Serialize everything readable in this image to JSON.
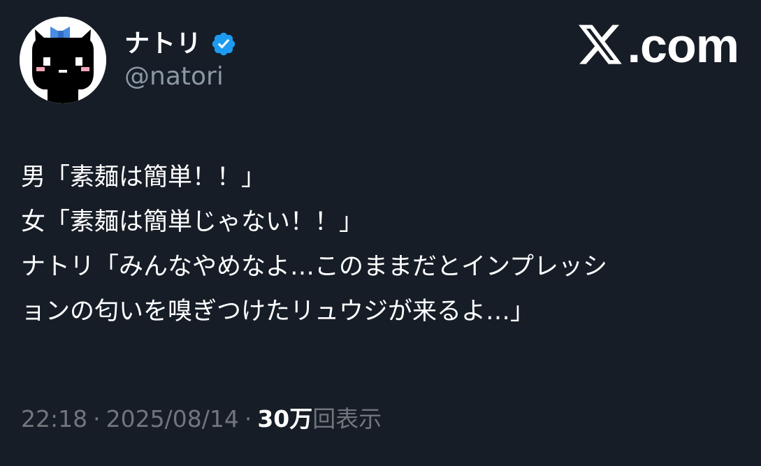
{
  "author": {
    "name": "ナトリ",
    "handle": "@natori",
    "verified": true,
    "avatar_icon": "pixel-cat-avatar"
  },
  "site": {
    "logo_icon": "x-logo-icon",
    "name_suffix": ".com"
  },
  "tweet": {
    "lines": [
      "男「素麺は簡単！！」",
      "女「素麺は簡単じゃない！！」",
      "ナトリ「みんなやめなよ…このままだとインプレッシ",
      "ョンの匂いを嗅ぎつけたリュウジが来るよ…」"
    ]
  },
  "meta": {
    "time": "22:18",
    "separator": "·",
    "date": "2025/08/14",
    "views_count": "30万",
    "views_label": "回表示"
  },
  "colors": {
    "background": "#161d27",
    "text_primary": "#ffffff",
    "text_secondary": "#8b98a5",
    "verified_badge": "#1d9bf0"
  }
}
